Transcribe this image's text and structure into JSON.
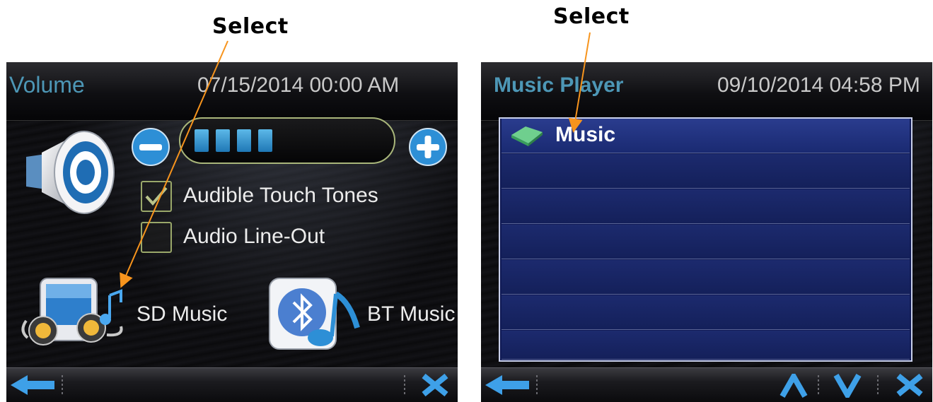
{
  "annotations": {
    "left_callout": "Select",
    "right_callout": "Select",
    "arrow_color": "#f7941d"
  },
  "volume_screen": {
    "title": "Volume",
    "datetime": "07/15/2014 00:00 AM",
    "volume_level_segments": 4,
    "options": [
      {
        "label": "Audible Touch Tones",
        "checked": true
      },
      {
        "label": "Audio Line-Out",
        "checked": false
      }
    ],
    "sources": [
      {
        "label": "SD Music",
        "icon": "sd-music-icon"
      },
      {
        "label": "BT Music",
        "icon": "bluetooth-music-icon"
      }
    ],
    "bottom_bar": {
      "back_icon": "back-arrow-icon",
      "close_icon": "close-icon"
    }
  },
  "music_player_screen": {
    "title": "Music Player",
    "datetime": "09/10/2014 04:58 PM",
    "list_items": [
      {
        "label": "Music",
        "icon": "folder-icon"
      },
      {
        "label": ""
      },
      {
        "label": ""
      },
      {
        "label": ""
      },
      {
        "label": ""
      },
      {
        "label": ""
      },
      {
        "label": ""
      }
    ],
    "bottom_bar": {
      "back_icon": "back-arrow-icon",
      "up_icon": "scroll-up-icon",
      "down_icon": "scroll-down-icon",
      "close_icon": "close-icon"
    }
  },
  "colors": {
    "title_blue": "#4d97b6",
    "accent_blue": "#2d8fd6",
    "list_blue": "#14205a",
    "check_green": "#9aa86a"
  }
}
